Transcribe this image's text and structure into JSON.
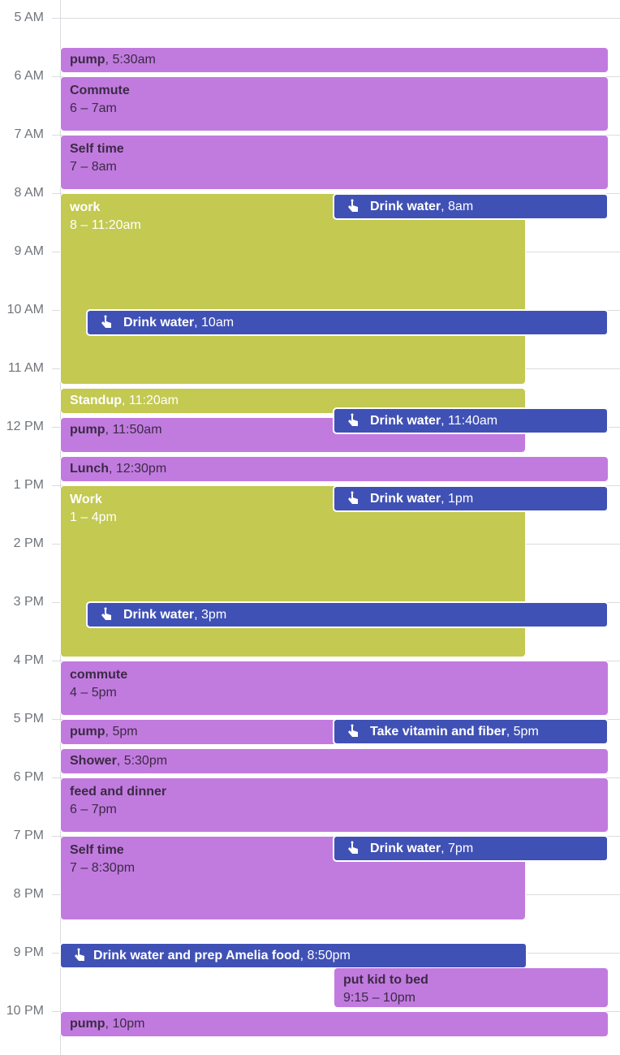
{
  "colors": {
    "purple": "#c17bdf",
    "olive": "#c3c951",
    "task_blue": "#4051b5"
  },
  "hours": [
    "5 AM",
    "6 AM",
    "7 AM",
    "8 AM",
    "9 AM",
    "10 AM",
    "11 AM",
    "12 PM",
    "1 PM",
    "2 PM",
    "3 PM",
    "4 PM",
    "5 PM",
    "6 PM",
    "7 PM",
    "8 PM",
    "9 PM",
    "10 PM"
  ],
  "events": [
    {
      "title": "pump",
      "time": "5:30am"
    },
    {
      "title": "Commute",
      "time": "6 – 7am"
    },
    {
      "title": "Self time",
      "time": "7 – 8am"
    },
    {
      "title": "work",
      "time": "8 – 11:20am"
    },
    {
      "title": "Drink water",
      "time": "8am"
    },
    {
      "title": "Drink water",
      "time": "10am"
    },
    {
      "title": "Standup",
      "time": "11:20am"
    },
    {
      "title": "Drink water",
      "time": "11:40am"
    },
    {
      "title": "pump",
      "time": "11:50am"
    },
    {
      "title": "Lunch",
      "time": "12:30pm"
    },
    {
      "title": "Work",
      "time": "1 – 4pm"
    },
    {
      "title": "Drink water",
      "time": "1pm"
    },
    {
      "title": "Drink water",
      "time": "3pm"
    },
    {
      "title": "commute",
      "time": "4 – 5pm"
    },
    {
      "title": "pump",
      "time": "5pm"
    },
    {
      "title": "Take vitamin and fiber",
      "time": "5pm"
    },
    {
      "title": "Shower",
      "time": "5:30pm"
    },
    {
      "title": "feed and dinner",
      "time": "6 – 7pm"
    },
    {
      "title": "Self time",
      "time": "7 – 8:30pm"
    },
    {
      "title": "Drink water",
      "time": "7pm"
    },
    {
      "title": "Drink water and prep Amelia food",
      "time": "8:50pm"
    },
    {
      "title": "put kid to bed",
      "time": "9:15 – 10pm"
    },
    {
      "title": "pump",
      "time": "10pm"
    }
  ]
}
